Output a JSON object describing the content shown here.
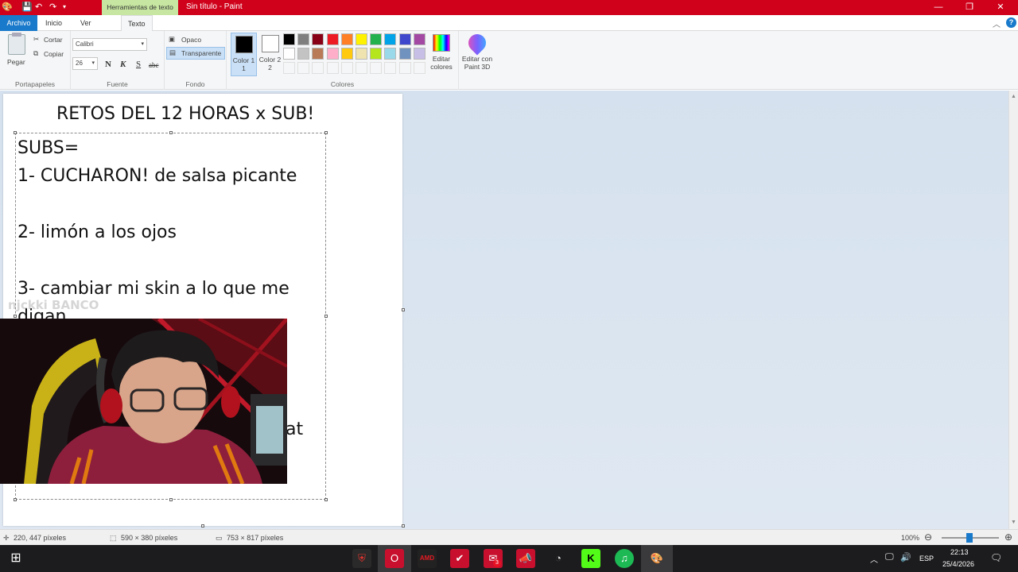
{
  "titlebar": {
    "context_tab": "Herramientas de texto",
    "title": "Sin título - Paint",
    "min": "—",
    "max": "❐",
    "close": "✕"
  },
  "tabs": {
    "archivo": "Archivo",
    "inicio": "Inicio",
    "ver": "Ver",
    "texto": "Texto"
  },
  "ribbon": {
    "portapapeles": {
      "label": "Portapapeles",
      "pegar": "Pegar",
      "cortar": "Cortar",
      "copiar": "Copiar"
    },
    "fuente": {
      "label": "Fuente",
      "family": "Calibri",
      "size": "26",
      "bold": "N",
      "italic": "K",
      "underline": "S",
      "strike": "abc"
    },
    "fondo": {
      "label": "Fondo",
      "opaco": "Opaco",
      "transparente": "Transparente"
    },
    "colores": {
      "label": "Colores",
      "color1": "Color 1",
      "color1b": "1",
      "color2": "Color 2",
      "color2b": "2",
      "color1_value": "#000000",
      "color2_value": "#ffffff",
      "palette_row1": [
        "#000000",
        "#7f7f7f",
        "#880015",
        "#ed1c24",
        "#ff7f27",
        "#fff200",
        "#22b14c",
        "#00a2e8",
        "#3f48cc",
        "#a349a4"
      ],
      "palette_row2": [
        "#ffffff",
        "#c3c3c3",
        "#b97a57",
        "#ffaec9",
        "#ffc90e",
        "#efe4b0",
        "#b5e61d",
        "#99d9ea",
        "#7092be",
        "#c8bfe7"
      ],
      "editar": "Editar",
      "colores": "colores",
      "editar_con": "Editar con",
      "paint3d": "Paint 3D"
    }
  },
  "canvas": {
    "heading": "RETOS DEL 12 HORAS x SUB!",
    "subs": "SUBS=",
    "line1": "1- CUCHARON! de salsa picante",
    "line2": "2- limón a los ojos",
    "line3": "3- cambiar mi skin a lo que me",
    "line3b": "digan",
    "line_fragment": "at",
    "watermark": "njckki BANCO"
  },
  "status": {
    "cursor_pos": "220, 447 píxeles",
    "selection_size": "590 × 380 píxeles",
    "image_size": "753 × 817 píxeles",
    "zoom": "100%"
  },
  "taskbar": {
    "lang": "ESP",
    "time": "22:13",
    "date": "25/4/2026",
    "badge": "3"
  }
}
